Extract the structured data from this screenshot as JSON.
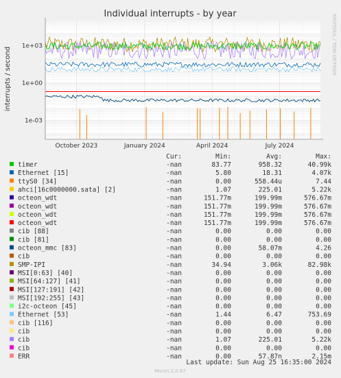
{
  "chart_data": {
    "type": "line",
    "title": "Individual interrupts - by year",
    "ylabel": "interrupts / second",
    "side_label": "RRDTOOL / TOBI OETIKER",
    "y_scale": "log",
    "ylim": [
      3e-05,
      100000
    ],
    "y_ticks": [
      {
        "value": 1000,
        "label": "1e+03"
      },
      {
        "value": 1,
        "label": "1e+00"
      },
      {
        "value": 0.001,
        "label": "1e-03"
      }
    ],
    "x_range": [
      "2023-08-20",
      "2024-08-25"
    ],
    "x_ticks": [
      {
        "date": "2023-10-01",
        "label": "October 2023"
      },
      {
        "date": "2024-01-01",
        "label": "January 2024"
      },
      {
        "date": "2024-04-01",
        "label": "April 2024"
      },
      {
        "date": "2024-07-01",
        "label": "July 2024"
      }
    ],
    "grid": true,
    "legend_headers": {
      "cur": "Cur:",
      "min": "Min:",
      "avg": "Avg:",
      "max": "Max:"
    },
    "series": [
      {
        "name": "timer",
        "color": "#00cc00",
        "cur": "-nan",
        "min": "83.77",
        "avg": "958.32",
        "max": "40.99k"
      },
      {
        "name": "Ethernet [15]",
        "color": "#0066b3",
        "cur": "-nan",
        "min": "5.80",
        "avg": "18.31",
        "max": "4.07k"
      },
      {
        "name": "ttyS0 [34]",
        "color": "#ff8000",
        "cur": "-nan",
        "min": "0.00",
        "avg": "558.44u",
        "max": "7.44"
      },
      {
        "name": "ahci[16c0000000.sata] [2]",
        "color": "#ffcc00",
        "cur": "-nan",
        "min": "1.07",
        "avg": "225.01",
        "max": "5.22k"
      },
      {
        "name": "octeon_wdt",
        "color": "#330099",
        "cur": "-nan",
        "min": "151.77m",
        "avg": "199.99m",
        "max": "576.67m"
      },
      {
        "name": "octeon_wdt",
        "color": "#990099",
        "cur": "-nan",
        "min": "151.77m",
        "avg": "199.99m",
        "max": "576.67m"
      },
      {
        "name": "octeon_wdt",
        "color": "#ccff00",
        "cur": "-nan",
        "min": "151.77m",
        "avg": "199.99m",
        "max": "576.67m"
      },
      {
        "name": "octeon_wdt",
        "color": "#ff0000",
        "cur": "-nan",
        "min": "151.77m",
        "avg": "199.99m",
        "max": "576.67m"
      },
      {
        "name": "cib [88]",
        "color": "#808080",
        "cur": "-nan",
        "min": "0.00",
        "avg": "0.00",
        "max": "0.00"
      },
      {
        "name": "cib [81]",
        "color": "#008f00",
        "cur": "-nan",
        "min": "0.00",
        "avg": "0.00",
        "max": "0.00"
      },
      {
        "name": "octeon_mmc [83]",
        "color": "#00487d",
        "cur": "-nan",
        "min": "0.00",
        "avg": "58.07m",
        "max": "4.26"
      },
      {
        "name": "cib",
        "color": "#b35a00",
        "cur": "-nan",
        "min": "0.00",
        "avg": "0.00",
        "max": "0.00"
      },
      {
        "name": "SMP-IPI",
        "color": "#b38f00",
        "cur": "-nan",
        "min": "34.94",
        "avg": "3.06k",
        "max": "82.98k"
      },
      {
        "name": "MSI[0:63] [40]",
        "color": "#6b006b",
        "cur": "-nan",
        "min": "0.00",
        "avg": "0.00",
        "max": "0.00"
      },
      {
        "name": "MSI[64:127] [41]",
        "color": "#8fb300",
        "cur": "-nan",
        "min": "0.00",
        "avg": "0.00",
        "max": "0.00"
      },
      {
        "name": "MSI[127:191] [42]",
        "color": "#b30000",
        "cur": "-nan",
        "min": "0.00",
        "avg": "0.00",
        "max": "0.00"
      },
      {
        "name": "MSI[192:255] [43]",
        "color": "#bebebe",
        "cur": "-nan",
        "min": "0.00",
        "avg": "0.00",
        "max": "0.00"
      },
      {
        "name": "i2c-octeon [45]",
        "color": "#80ff80",
        "cur": "-nan",
        "min": "0.00",
        "avg": "0.00",
        "max": "0.00"
      },
      {
        "name": "Ethernet [53]",
        "color": "#80c9ff",
        "cur": "-nan",
        "min": "1.44",
        "avg": "6.47",
        "max": "753.69"
      },
      {
        "name": "cib [116]",
        "color": "#ffc080",
        "cur": "-nan",
        "min": "0.00",
        "avg": "0.00",
        "max": "0.00"
      },
      {
        "name": "cib",
        "color": "#ffe680",
        "cur": "-nan",
        "min": "0.00",
        "avg": "0.00",
        "max": "0.00"
      },
      {
        "name": "cib",
        "color": "#aa80ff",
        "cur": "-nan",
        "min": "1.07",
        "avg": "225.01",
        "max": "5.22k"
      },
      {
        "name": "cib",
        "color": "#ee00cc",
        "cur": "-nan",
        "min": "0.00",
        "avg": "0.00",
        "max": "0.00"
      },
      {
        "name": "ERR",
        "color": "#ff8080",
        "cur": "-nan",
        "min": "0.00",
        "avg": "57.87n",
        "max": "2.15m"
      }
    ],
    "last_update": "Last update: Sun Aug 25 16:35:00 2024",
    "footer": "Munin 2.0.67"
  }
}
